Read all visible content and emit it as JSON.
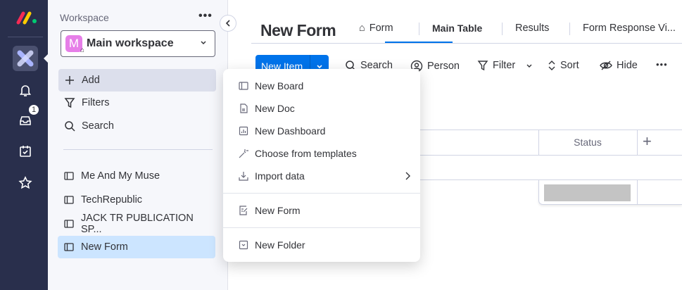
{
  "rail": {
    "notifications_badge": "1",
    "logo_text": "monday"
  },
  "sidebar": {
    "workspace_label": "Workspace",
    "workspace_name": "Main workspace",
    "workspace_initial": "M",
    "actions": [
      {
        "label": "Add",
        "icon": "plus-icon"
      },
      {
        "label": "Filters",
        "icon": "filter-icon"
      },
      {
        "label": "Search",
        "icon": "search-icon"
      }
    ],
    "items": [
      {
        "label": "Me And My Muse"
      },
      {
        "label": "TechRepublic"
      },
      {
        "label": "JACK TR PUBLICATION SP..."
      },
      {
        "label": "New Form",
        "selected": true
      }
    ]
  },
  "main": {
    "title": "New Form",
    "tabs": [
      {
        "label": "Form"
      },
      {
        "label": "Main Table",
        "active": true
      },
      {
        "label": "Results"
      },
      {
        "label": "Form Response Vi..."
      }
    ],
    "toolbar": {
      "new_item": "New Item",
      "search": "Search",
      "person": "Person",
      "filter": "Filter",
      "sort": "Sort",
      "hide": "Hide"
    },
    "table": {
      "columns": [
        "Status"
      ]
    }
  },
  "add_menu": {
    "items": [
      "New Board",
      "New Doc",
      "New Dashboard",
      "Choose from templates",
      "Import data",
      "New Form",
      "New Folder"
    ]
  },
  "colors": {
    "rail": "#292f4c",
    "accent": "#0073ea",
    "selected": "#cce5ff"
  }
}
